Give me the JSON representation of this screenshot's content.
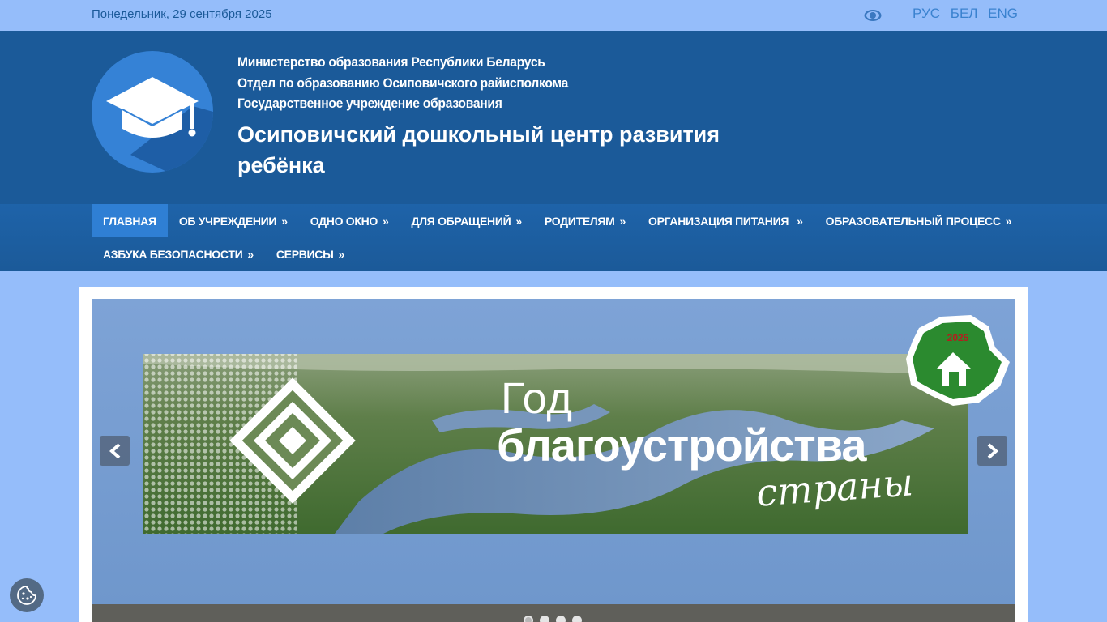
{
  "topbar": {
    "date": "Понедельник, 29 сентября 2025",
    "eye_icon": "eye-icon",
    "languages": [
      "РУС",
      "БЕЛ",
      "ENG"
    ]
  },
  "header": {
    "lines": [
      "Министерство образования Республики Беларусь",
      "Отдел по образованию Осиповичского райисполкома",
      "Государственное учреждение образования"
    ],
    "title": "Осиповичский дошкольный центр развития ребёнка",
    "logo_icon": "graduation-cap-icon"
  },
  "nav": {
    "row1": [
      {
        "label": "ГЛАВНАЯ",
        "arrow": ""
      },
      {
        "label": "ОБ УЧРЕЖДЕНИИ",
        "arrow": "»"
      },
      {
        "label": "ОДНО ОКНО",
        "arrow": "»"
      },
      {
        "label": "ДЛЯ ОБРАЩЕНИЙ",
        "arrow": "»"
      },
      {
        "label": "РОДИТЕЛЯМ",
        "arrow": "»"
      },
      {
        "label": "ОРГАНИЗАЦИЯ ПИТАНИЯ",
        "arrow": "»"
      },
      {
        "label": "ОБРАЗОВАТЕЛЬНЫЙ ПРОЦЕСС",
        "arrow": "»"
      }
    ],
    "row2": [
      {
        "label": "АЗБУКА БЕЗОПАСНОСТИ",
        "arrow": "»"
      },
      {
        "label": "СЕРВИСЫ",
        "arrow": "»"
      }
    ]
  },
  "slider": {
    "banner_line1": "Год",
    "banner_line2": "благоустройства",
    "banner_line3": "страны",
    "badge_year": "2025",
    "slide_count": 4,
    "active_slide": 1
  },
  "colors": {
    "background": "#95bdfa",
    "header": "#1b5a99",
    "nav_active": "#2f7fd4"
  }
}
